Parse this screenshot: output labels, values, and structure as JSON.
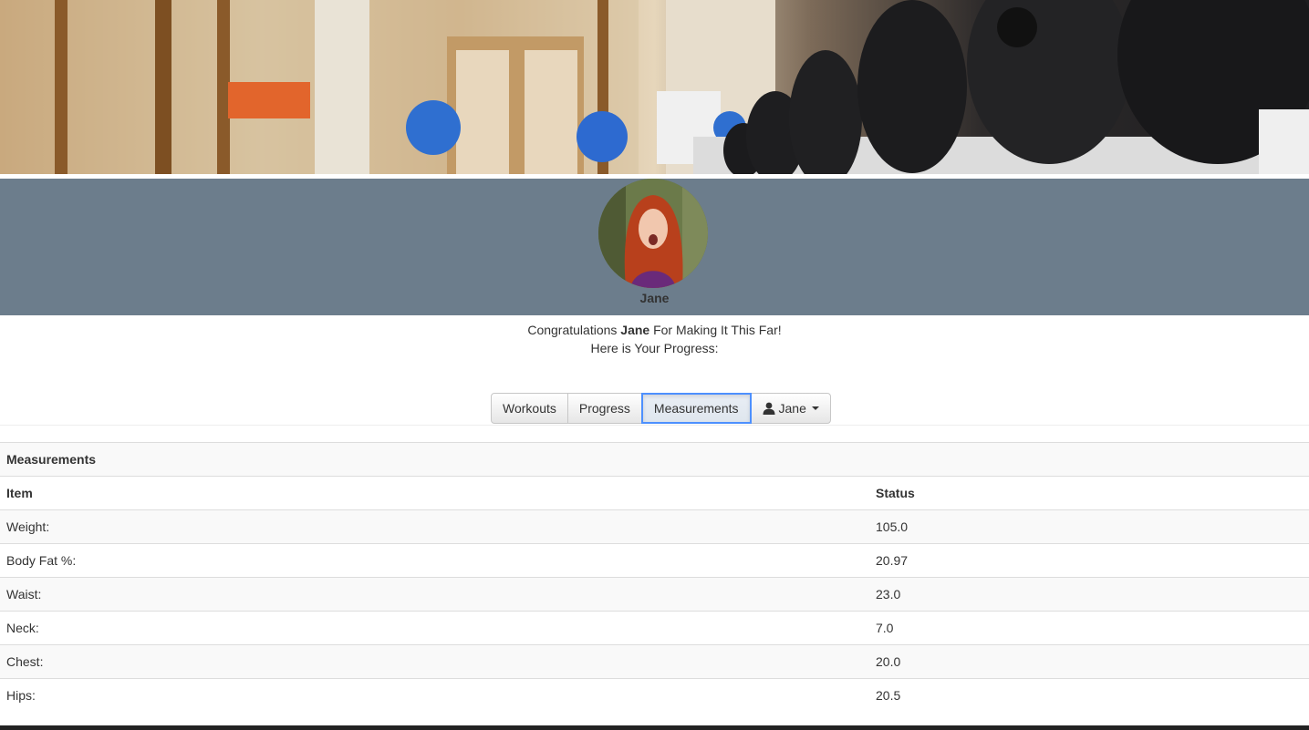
{
  "profile": {
    "name": "Jane"
  },
  "greeting": {
    "prefix": "Congratulations ",
    "name": "Jane",
    "suffix": " For Making It This Far!",
    "line2": "Here is Your Progress:"
  },
  "nav": {
    "workouts": "Workouts",
    "progress": "Progress",
    "measurements": "Measurements",
    "user": "Jane",
    "active": "measurements"
  },
  "table": {
    "title": "Measurements",
    "headers": [
      "Item",
      "Status"
    ],
    "rows": [
      {
        "item": "Weight:",
        "status": "105.0"
      },
      {
        "item": "Body Fat %:",
        "status": "20.97"
      },
      {
        "item": "Waist:",
        "status": "23.0"
      },
      {
        "item": "Neck:",
        "status": "7.0"
      },
      {
        "item": "Chest:",
        "status": "20.0"
      },
      {
        "item": "Hips:",
        "status": "20.5"
      }
    ]
  },
  "colors": {
    "profile_band": "#6c7d8c",
    "active_border": "#4d90fe"
  },
  "icons": {
    "hero": "gym-dumbbells-photo",
    "avatar": "profile-photo",
    "user": "user-icon",
    "dropdown": "caret-down-icon"
  }
}
